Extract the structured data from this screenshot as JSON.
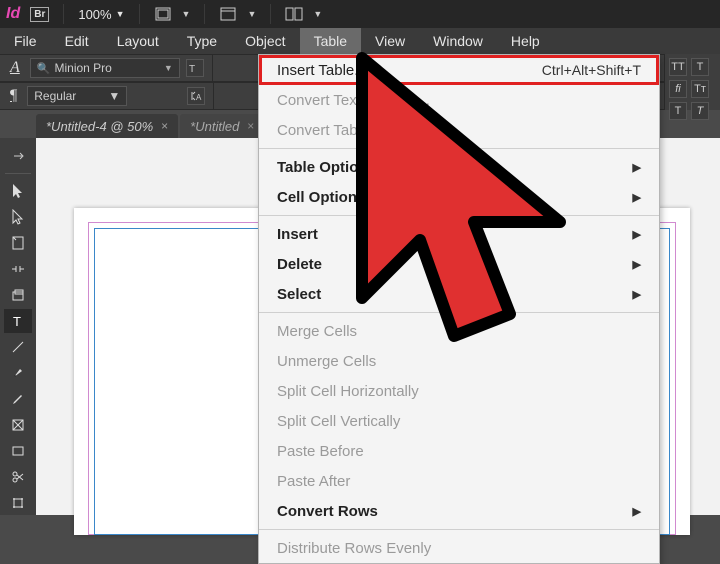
{
  "titlebar": {
    "zoom": "100%"
  },
  "menubar": {
    "items": [
      "File",
      "Edit",
      "Layout",
      "Type",
      "Object",
      "Table",
      "View",
      "Window",
      "Help"
    ],
    "active_index": 5
  },
  "controlbar": {
    "char_icon": "A",
    "font_name": "Minion Pro",
    "font_style": "Regular",
    "para_icon": "¶",
    "tt": "TT",
    "fi": "fi",
    "t_italic": "T"
  },
  "tabs": {
    "items": [
      {
        "label": "*Untitled-4 @ 50%",
        "active": true
      },
      {
        "label": "*Untitled",
        "active": false
      }
    ]
  },
  "dropdown": {
    "items": [
      {
        "label": "Insert Table...",
        "shortcut": "Ctrl+Alt+Shift+T",
        "highlight": true
      },
      {
        "label": "Convert Text to Table...",
        "disabled": true
      },
      {
        "label": "Convert Table",
        "disabled": true
      },
      {
        "type": "sep"
      },
      {
        "label": "Table Options",
        "bold": true,
        "submenu": true
      },
      {
        "label": "Cell Options",
        "bold": true,
        "submenu": true
      },
      {
        "type": "sep"
      },
      {
        "label": "Insert",
        "bold": true,
        "submenu": true
      },
      {
        "label": "Delete",
        "bold": true,
        "submenu": true
      },
      {
        "label": "Select",
        "bold": true,
        "submenu": true
      },
      {
        "type": "sep"
      },
      {
        "label": "Merge Cells",
        "disabled": true
      },
      {
        "label": "Unmerge Cells",
        "disabled": true
      },
      {
        "label": "Split Cell Horizontally",
        "disabled": true
      },
      {
        "label": "Split Cell Vertically",
        "disabled": true
      },
      {
        "label": "Paste Before",
        "disabled": true
      },
      {
        "label": "Paste After",
        "disabled": true
      },
      {
        "label": "Convert Rows",
        "bold": true,
        "submenu": true
      },
      {
        "type": "sep"
      },
      {
        "label": "Distribute Rows Evenly",
        "disabled": true
      }
    ]
  }
}
